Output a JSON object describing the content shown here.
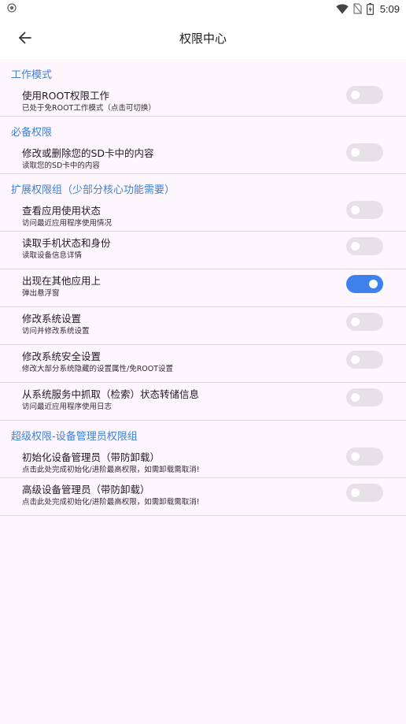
{
  "status_bar": {
    "time": "5:09",
    "icons": [
      "location-indicator-icon",
      "wifi-icon",
      "no-sim-icon",
      "battery-icon"
    ]
  },
  "app_bar": {
    "title": "权限中心",
    "back_icon": "arrow-left-icon"
  },
  "colors": {
    "section_header": "#3f7fd8",
    "toggle_on": "#3f81ec",
    "toggle_off": "#e6e1e7",
    "background": "#fdf7fd"
  },
  "sections": [
    {
      "header": "工作模式",
      "items": [
        {
          "title": "使用ROOT权限工作",
          "subtitle": "已处于免ROOT工作模式（点击可切换）",
          "enabled": false
        }
      ]
    },
    {
      "header": "必备权限",
      "items": [
        {
          "title": "修改或删除您的SD卡中的内容",
          "subtitle": "读取您的SD卡中的内容",
          "enabled": false
        }
      ]
    },
    {
      "header": "扩展权限组（少部分核心功能需要）",
      "items": [
        {
          "title": "查看应用使用状态",
          "subtitle": "访问最近应用程序使用情况",
          "enabled": false
        },
        {
          "title": "读取手机状态和身份",
          "subtitle": "读取设备信息详情",
          "enabled": false
        },
        {
          "title": "出现在其他应用上",
          "subtitle": "弹出悬浮窗",
          "enabled": true
        },
        {
          "title": "修改系统设置",
          "subtitle": "访问并修改系统设置",
          "enabled": false
        },
        {
          "title": "修改系统安全设置",
          "subtitle": "修改大部分系统隐藏的设置属性/免ROOT设置",
          "enabled": false
        },
        {
          "title": "从系统服务中抓取（检索）状态转储信息",
          "subtitle": "访问最近应用程序使用日志",
          "enabled": false
        }
      ]
    },
    {
      "header": "超级权限-设备管理员权限组",
      "items": [
        {
          "title": "初始化设备管理员（带防卸载）",
          "subtitle": "点击此处完成初始化/进阶最高权限，如需卸载需取消!",
          "enabled": false
        },
        {
          "title": "高级设备管理员（带防卸载）",
          "subtitle": "点击此处完成初始化/进阶最高权限，如需卸载需取消!",
          "enabled": false
        }
      ]
    }
  ]
}
